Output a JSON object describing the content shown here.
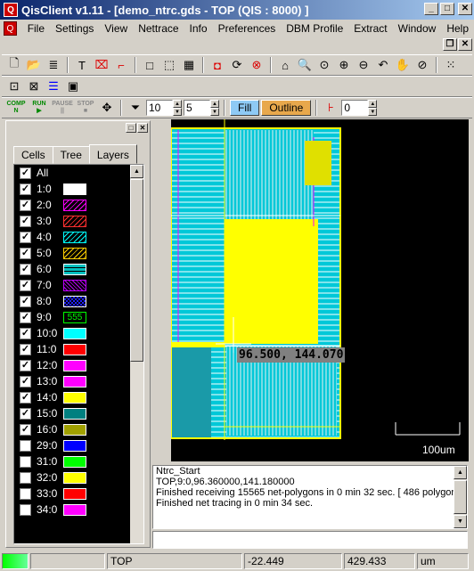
{
  "app": {
    "title": "QisClient v1.11 - [demo_ntrc.gds - TOP (QIS : 8000) ]",
    "icon_letter": "Q"
  },
  "menu": [
    "File",
    "Settings",
    "View",
    "Nettrace",
    "Info",
    "Preferences",
    "DBM Profile",
    "Extract",
    "Window",
    "Help"
  ],
  "toolbar2": {
    "filter_depth": "10",
    "filter_levels": "5",
    "fill_label": "Fill",
    "outline_label": "Outline",
    "level_value": "0"
  },
  "run_buttons": [
    {
      "top": "COMP",
      "bottom": "N"
    },
    {
      "top": "RUN",
      "bottom": "▶"
    },
    {
      "top": "PAUSE",
      "bottom": "||"
    },
    {
      "top": "STOP",
      "bottom": "■"
    }
  ],
  "panel": {
    "tabs": [
      "Cells",
      "Tree",
      "Layers"
    ],
    "active_tab": "Layers"
  },
  "layers": [
    {
      "name": "All",
      "checked": true,
      "color": ""
    },
    {
      "name": "1:0",
      "checked": true,
      "color": "#ffffff"
    },
    {
      "name": "2:0",
      "checked": true,
      "color": "#ff00ff",
      "pattern": "hatch"
    },
    {
      "name": "3:0",
      "checked": true,
      "color": "#ff3030",
      "pattern": "hatch"
    },
    {
      "name": "4:0",
      "checked": true,
      "color": "#00ffff",
      "pattern": "hatch"
    },
    {
      "name": "5:0",
      "checked": true,
      "color": "#ffd000",
      "pattern": "hatch"
    },
    {
      "name": "6:0",
      "checked": true,
      "color": "#00c0c0",
      "pattern": "brick"
    },
    {
      "name": "7:0",
      "checked": true,
      "color": "#c000ff",
      "pattern": "cross"
    },
    {
      "name": "8:0",
      "checked": true,
      "color": "#2020ff",
      "pattern": "check"
    },
    {
      "name": "9:0",
      "checked": true,
      "color": "#00ff00",
      "pattern": "text",
      "text": "555"
    },
    {
      "name": "10:0",
      "checked": true,
      "color": "#00ffff"
    },
    {
      "name": "11:0",
      "checked": true,
      "color": "#ff0000"
    },
    {
      "name": "12:0",
      "checked": true,
      "color": "#ff00ff"
    },
    {
      "name": "13:0",
      "checked": true,
      "color": "#ff00ff"
    },
    {
      "name": "14:0",
      "checked": true,
      "color": "#ffff00"
    },
    {
      "name": "15:0",
      "checked": true,
      "color": "#008080"
    },
    {
      "name": "16:0",
      "checked": true,
      "color": "#a0a000"
    },
    {
      "name": "29:0",
      "checked": false,
      "color": "#0000ff"
    },
    {
      "name": "31:0",
      "checked": false,
      "color": "#00ff00"
    },
    {
      "name": "32:0",
      "checked": false,
      "color": "#ffff00"
    },
    {
      "name": "33:0",
      "checked": false,
      "color": "#ff0000"
    },
    {
      "name": "34:0",
      "checked": false,
      "color": "#ff00ff"
    }
  ],
  "canvas": {
    "cursor_coords": "96.500, 144.070",
    "scale_label": "100um"
  },
  "log": [
    "Ntrc_Start",
    "TOP,9:0,96.360000,141.180000",
    "Finished receiving 15565 net-polygons in 0 min 32 sec. [ 486 polygons",
    "Finished net tracing in 0 min 34 sec."
  ],
  "status": {
    "cell": "TOP",
    "x": "-22.449",
    "y": "429.433",
    "unit": "um"
  }
}
